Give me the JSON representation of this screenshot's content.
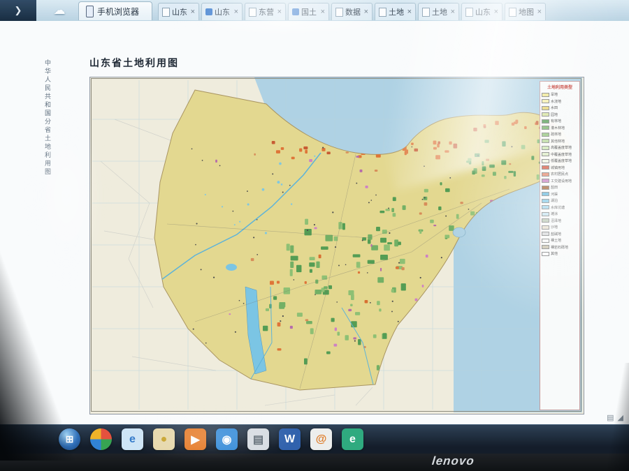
{
  "browser": {
    "nav": {
      "back_glyph": "❯",
      "cloud_glyph": "☁"
    },
    "active_tab": {
      "label": "手机浏览器"
    },
    "close_glyph": "×",
    "tabs": [
      {
        "label": "山东",
        "icon": "doc"
      },
      {
        "label": "山东",
        "icon": "site"
      },
      {
        "label": "东营",
        "icon": "doc"
      },
      {
        "label": "国土",
        "icon": "site"
      },
      {
        "label": "数据",
        "icon": "doc"
      },
      {
        "label": "土地",
        "icon": "doc"
      },
      {
        "label": "土地",
        "icon": "doc"
      },
      {
        "label": "山东",
        "icon": "doc"
      },
      {
        "label": "地图",
        "icon": "doc"
      }
    ]
  },
  "page": {
    "spine_text": "中华人民共和国分省土地利用图",
    "title": "山东省土地利用图",
    "corner_glyphs": [
      "▤",
      "◢"
    ]
  },
  "map": {
    "colors": {
      "sea": "#aed2e4",
      "land": "#e5d88c",
      "paper": "#f2eedd",
      "forest": [
        "#4f9a4c",
        "#6fae5e",
        "#8cbf6e"
      ],
      "urban": [
        "#c8562a",
        "#e0702f"
      ],
      "town": [
        "#cf7ec2",
        "#b668a8",
        "#d98a52"
      ],
      "orange": [
        "#e07030",
        "#d86a28"
      ],
      "pond": [
        "#7ec8e0"
      ],
      "river": "#58b2d8",
      "grid": "#b8d4de"
    },
    "legend": {
      "title": "土地利用类型",
      "items": [
        {
          "color": "#f2e88f",
          "label": "旱地"
        },
        {
          "color": "#f8f1a8",
          "label": "水浇地"
        },
        {
          "color": "#e8d36b",
          "label": "水田"
        },
        {
          "color": "#d9e49a",
          "label": "园地"
        },
        {
          "color": "#4f9a4c",
          "label": "有林地"
        },
        {
          "color": "#6fae5e",
          "label": "灌木林地"
        },
        {
          "color": "#8cbf6e",
          "label": "疏林地"
        },
        {
          "color": "#b2d48e",
          "label": "其他林地"
        },
        {
          "color": "#cde6ac",
          "label": "高覆盖度草地"
        },
        {
          "color": "#e0eec6",
          "label": "中覆盖度草地"
        },
        {
          "color": "#f0f6e0",
          "label": "低覆盖度草地"
        },
        {
          "color": "#d85a42",
          "label": "城镇用地"
        },
        {
          "color": "#e8886a",
          "label": "农村居民点"
        },
        {
          "color": "#c87ec0",
          "label": "工交建设用地"
        },
        {
          "color": "#a05a28",
          "label": "盐田"
        },
        {
          "color": "#58b2d8",
          "label": "河渠"
        },
        {
          "color": "#78c4e4",
          "label": "湖泊"
        },
        {
          "color": "#98d2ea",
          "label": "水库坑塘"
        },
        {
          "color": "#c0e2f0",
          "label": "滩涂"
        },
        {
          "color": "#b8c8b0",
          "label": "沼泽地"
        },
        {
          "color": "#e8e0cc",
          "label": "沙地"
        },
        {
          "color": "#d8d8d8",
          "label": "盐碱地"
        },
        {
          "color": "#f8f8f6",
          "label": "裸土地"
        },
        {
          "color": "#c8c0a8",
          "label": "裸岩石砾地"
        },
        {
          "color": "#ffffff",
          "label": "其他"
        }
      ]
    }
  },
  "taskbar": {
    "icons": [
      {
        "name": "start-button",
        "glyph": "⊞",
        "style": "orb",
        "bg": "",
        "fg": "#ffffff"
      },
      {
        "name": "pinwheel-browser",
        "glyph": "",
        "style": "pinwheel",
        "bg": "",
        "fg": "#ffffff"
      },
      {
        "name": "internet-explorer",
        "glyph": "e",
        "style": "plain",
        "bg": "#cfe6f7",
        "fg": "#2a74c8"
      },
      {
        "name": "yellow-sphere-app",
        "glyph": "●",
        "style": "plain",
        "bg": "#e8d9a8",
        "fg": "#c8a020"
      },
      {
        "name": "media-player",
        "glyph": "▶",
        "style": "plain",
        "bg": "#e87820",
        "fg": "#ffffff"
      },
      {
        "name": "reader-app",
        "glyph": "◉",
        "style": "plain",
        "bg": "#2f88d8",
        "fg": "#ffffff"
      },
      {
        "name": "printer-app",
        "glyph": "▤",
        "style": "plain",
        "bg": "#d8dde2",
        "fg": "#55606a"
      },
      {
        "name": "word",
        "glyph": "W",
        "style": "plain",
        "bg": "#2a5caa",
        "fg": "#ffffff"
      },
      {
        "name": "mail-app",
        "glyph": "@",
        "style": "plain",
        "bg": "#f0f0ee",
        "fg": "#e07820"
      },
      {
        "name": "green-browser",
        "glyph": "e",
        "style": "plain",
        "bg": "#28a87a",
        "fg": "#ffffff"
      }
    ]
  },
  "laptop": {
    "brand": "lenovo"
  }
}
